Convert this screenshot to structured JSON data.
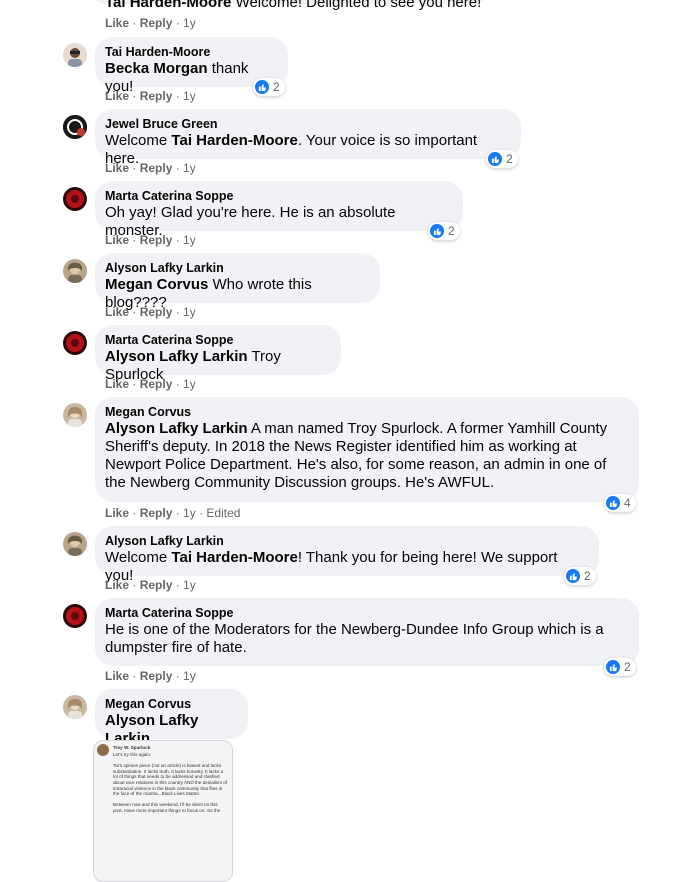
{
  "top_partial": {
    "author": "Tai Harden-Moore",
    "text": "Welcome! Delighted to see you here!",
    "like": "Like",
    "reply": "Reply",
    "time": "1y"
  },
  "comments": [
    {
      "author": "Tai Harden-Moore",
      "mention": "Becka Morgan",
      "text": " thank you!",
      "like": "Like",
      "reply": "Reply",
      "time": "1y",
      "reactions": "2"
    },
    {
      "author": "Jewel Bruce Green",
      "pre": "Welcome ",
      "mention": "Tai Harden-Moore",
      "text": ". Your voice is so important here.",
      "like": "Like",
      "reply": "Reply",
      "time": "1y",
      "reactions": "2"
    },
    {
      "author": "Marta Caterina Soppe",
      "text": "Oh yay! Glad you're here. He is an absolute monster.",
      "like": "Like",
      "reply": "Reply",
      "time": "1y",
      "reactions": "2"
    },
    {
      "author": "Alyson Lafky Larkin",
      "mention": "Megan Corvus",
      "text": " Who wrote this blog????",
      "like": "Like",
      "reply": "Reply",
      "time": "1y"
    },
    {
      "author": "Marta Caterina Soppe",
      "mention": "Alyson Lafky Larkin",
      "text": " Troy Spurlock",
      "like": "Like",
      "reply": "Reply",
      "time": "1y"
    },
    {
      "author": "Megan Corvus",
      "mention": "Alyson Lafky Larkin",
      "text": " A man named Troy Spurlock. A former Yamhill County Sheriff's deputy. In 2018 the News Register identified him as working at Newport Police Department. He's also, for some reason, an admin in one of the Newberg Community Discussion groups. He's AWFUL.",
      "like": "Like",
      "reply": "Reply",
      "time": "1y",
      "edited": "Edited",
      "reactions": "4"
    },
    {
      "author": "Alyson Lafky Larkin",
      "pre": "Welcome ",
      "mention": "Tai Harden-Moore",
      "text": "! Thank you for being here! We support you!",
      "like": "Like",
      "reply": "Reply",
      "time": "1y",
      "reactions": "2"
    },
    {
      "author": "Marta Caterina Soppe",
      "text": "He is one of the Moderators for the Newberg-Dundee Info Group which is a dumpster fire of hate.",
      "like": "Like",
      "reply": "Reply",
      "time": "1y",
      "reactions": "2"
    },
    {
      "author": "Megan Corvus",
      "mention": "Alyson Lafky Larkin",
      "text": ""
    }
  ],
  "attachment": {
    "name": "Troy W. Spurlock",
    "text": "Let's try this again.\n\nTai's opinion piece (not an article) is biased and lacks substantiation. It lacks truth. It lacks honesty. It lacks a lot of things that needs to be addressed and clarified about race relations in this country AND the denialism of intraracial violence in the black community that flies in the face of the mantra...Black Lives Matter.\n\nBetween now and this weekend, I'll be silent on this post. Have more important things to focus on. So the"
  },
  "colors": {
    "bubble": "#f0f2f5",
    "like_blue": "#1877f2",
    "meta_gray": "#65676b"
  }
}
